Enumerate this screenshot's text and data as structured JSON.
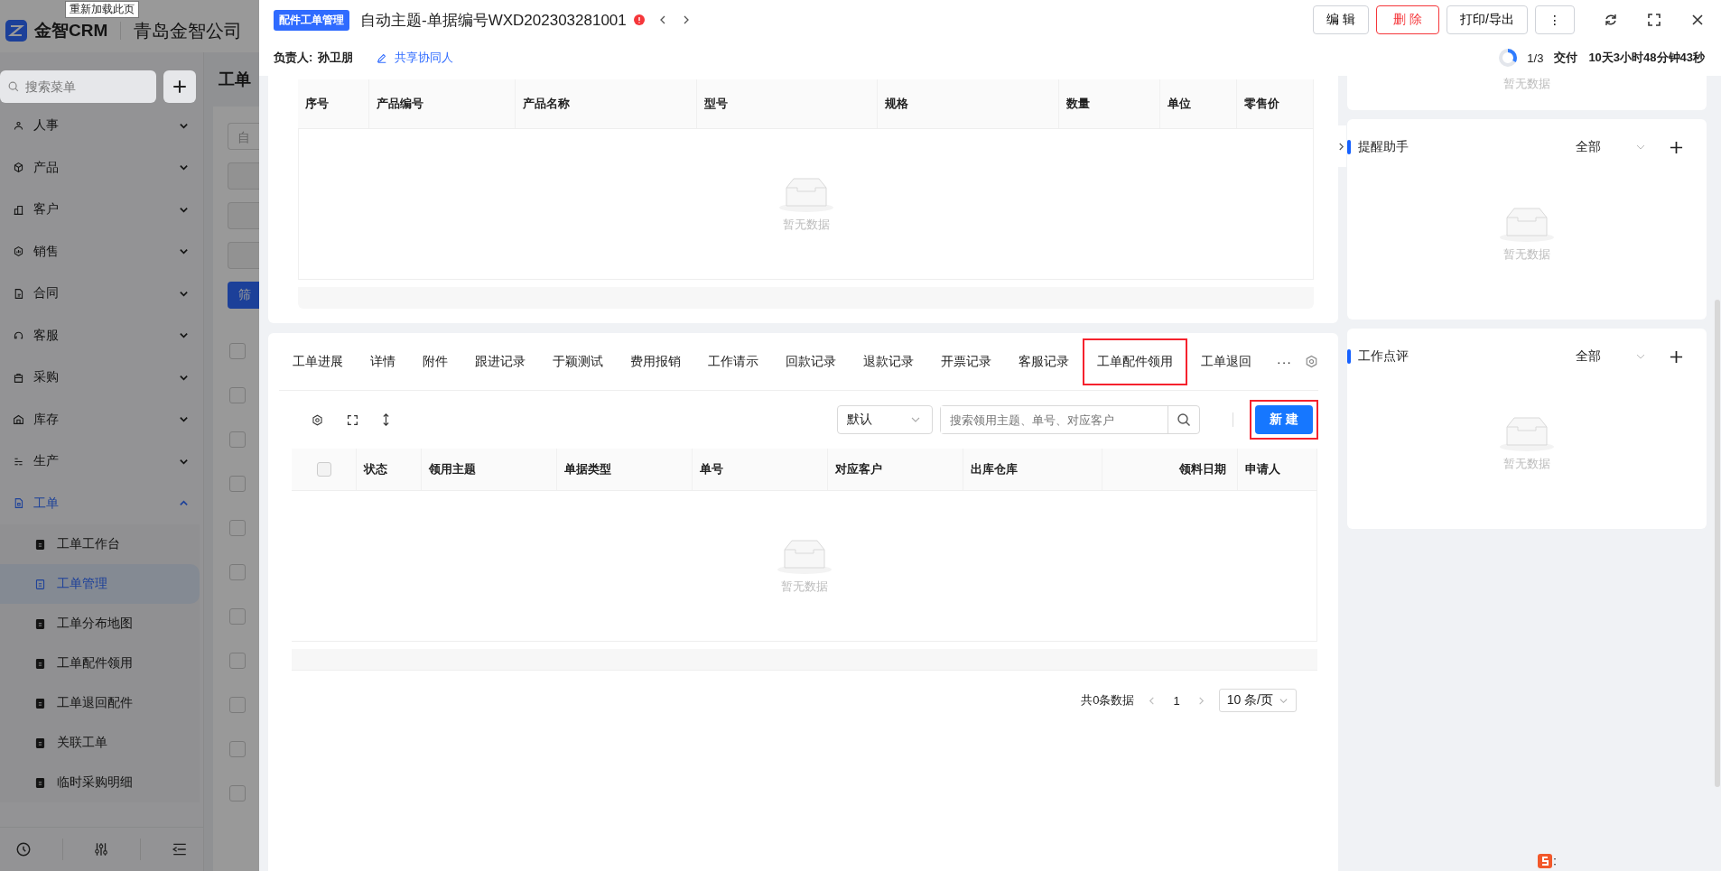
{
  "app": {
    "brand": "金智CRM",
    "company": "青岛金智公司",
    "tooltip": "重新加载此页",
    "search_placeholder": "搜索菜单",
    "page_title": "工单",
    "filter_text": "自",
    "filter_button": "筛",
    "rows": [
      {
        "checked": false
      },
      {
        "checked": false
      },
      {
        "checked": false
      },
      {
        "checked": false
      },
      {
        "checked": false
      },
      {
        "checked": false
      },
      {
        "checked": false
      },
      {
        "checked": false
      },
      {
        "checked": false
      },
      {
        "checked": false
      },
      {
        "checked": false
      }
    ]
  },
  "sidebar": {
    "items": [
      {
        "label": "人事",
        "expanded": false
      },
      {
        "label": "产品",
        "expanded": false
      },
      {
        "label": "客户",
        "expanded": false
      },
      {
        "label": "销售",
        "expanded": false
      },
      {
        "label": "合同",
        "expanded": false
      },
      {
        "label": "客服",
        "expanded": false
      },
      {
        "label": "采购",
        "expanded": false
      },
      {
        "label": "库存",
        "expanded": false
      },
      {
        "label": "生产",
        "expanded": false
      },
      {
        "label": "工单",
        "expanded": true,
        "children": [
          {
            "label": "工单工作台",
            "selected": false
          },
          {
            "label": "工单管理",
            "selected": true
          },
          {
            "label": "工单分布地图",
            "selected": false
          },
          {
            "label": "工单配件领用",
            "selected": false
          },
          {
            "label": "工单退回配件",
            "selected": false
          },
          {
            "label": "关联工单",
            "selected": false
          },
          {
            "label": "临时采购明细",
            "selected": false
          }
        ]
      }
    ]
  },
  "drawer": {
    "badge": "配件工单管理",
    "title": "自动主题-单据编号WXD202303281001",
    "buttons": [
      {
        "label": "编 辑",
        "kind": "default"
      },
      {
        "label": "删 除",
        "kind": "danger"
      },
      {
        "label": "打印/导出",
        "kind": "default"
      },
      {
        "label": "⋮",
        "kind": "default"
      }
    ],
    "owner_label": "负责人:",
    "owner": "孙卫朋",
    "share": "共享协同人",
    "progress": {
      "level": 0.33,
      "text": "1/3"
    },
    "stage": "交付",
    "elapsed": "10天3小时48分钟43秒"
  },
  "products_table": {
    "columns": [
      "序号",
      "产品编号",
      "产品名称",
      "型号",
      "规格",
      "数量",
      "单位",
      "零售价"
    ],
    "empty": "暂无数据"
  },
  "tabs": [
    {
      "label": "工单进展",
      "selected": false
    },
    {
      "label": "详情",
      "selected": false
    },
    {
      "label": "附件",
      "selected": false
    },
    {
      "label": "跟进记录",
      "selected": false
    },
    {
      "label": "于颖测试",
      "selected": false
    },
    {
      "label": "费用报销",
      "selected": false
    },
    {
      "label": "工作请示",
      "selected": false
    },
    {
      "label": "回款记录",
      "selected": false
    },
    {
      "label": "退款记录",
      "selected": false
    },
    {
      "label": "开票记录",
      "selected": false
    },
    {
      "label": "客服记录",
      "selected": false
    },
    {
      "label": "工单配件领用",
      "selected": true
    },
    {
      "label": "工单退回",
      "selected": false
    }
  ],
  "more_tabs": "···",
  "toolbar": {
    "filter": "默认",
    "search_placeholder": "搜索领用主题、单号、对应客户",
    "new_button": {
      "label": "新 建",
      "highlighted": true
    }
  },
  "requisition_table": {
    "select_all": {
      "checked": false
    },
    "columns": [
      "状态",
      "领用主题",
      "单据类型",
      "单号",
      "对应客户",
      "出库仓库",
      "领料日期",
      "申请人"
    ],
    "empty": "暂无数据"
  },
  "pagination": {
    "total": "共0条数据",
    "page": "1",
    "page_size": "10 条/页"
  },
  "side_panels": [
    {
      "empty": "暂无数据"
    },
    {
      "title": "提醒助手",
      "filter": "全部",
      "empty": "暂无数据"
    },
    {
      "title": "工作点评",
      "filter": "全部",
      "empty": "暂无数据"
    }
  ]
}
